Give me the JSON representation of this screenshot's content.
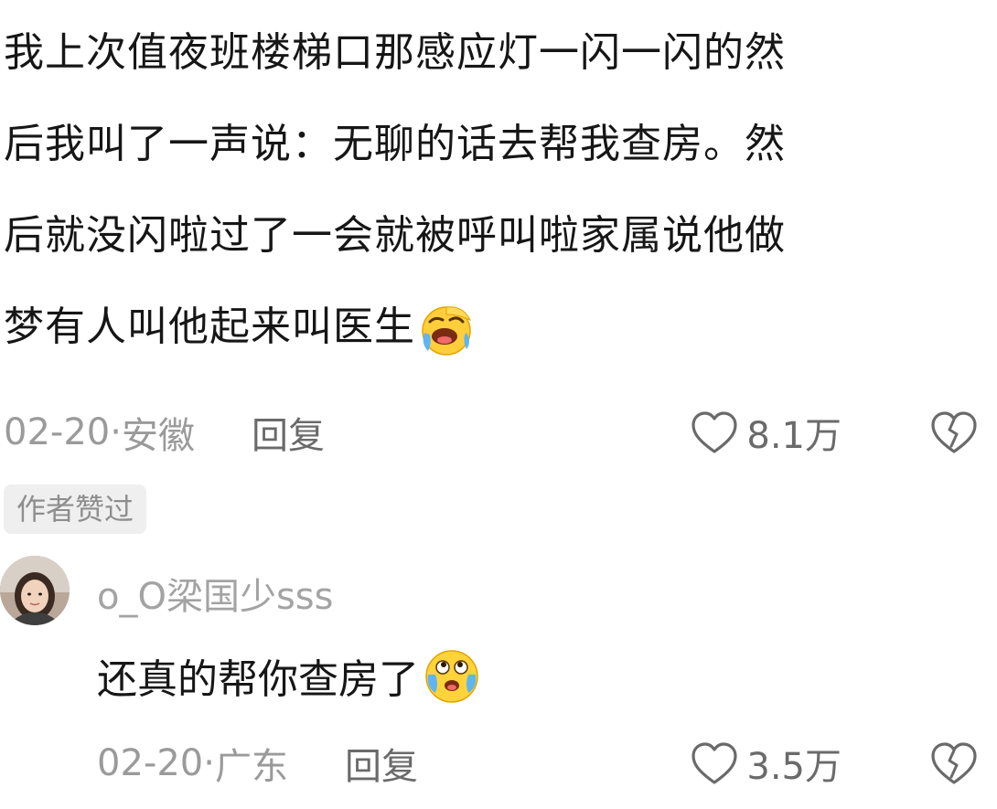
{
  "main_comment": {
    "lines": [
      "我上次值夜班楼梯口那感应灯一闪一闪的然",
      "后我叫了一声说：无聊的话去帮我查房。然",
      "后就没闪啦过了一会就被呼叫啦家属说他做",
      "梦有人叫他起来叫医生"
    ],
    "emoji": "laughing-crying-emoji",
    "date": "02-20",
    "separator": " · ",
    "location": "安徽",
    "reply_label": "回复",
    "like_count": "8.1万"
  },
  "author_liked_badge": "作者赞过",
  "reply_comment": {
    "username": "o_O梁国少sss",
    "text": "还真的帮你查房了",
    "emoji": "crying-laughing-emoji",
    "date": "02-20",
    "separator": " · ",
    "location": "广东",
    "reply_label": "回复",
    "like_count": "3.5万"
  },
  "icons": {
    "like": "heart-outline-icon",
    "dislike": "broken-heart-outline-icon"
  },
  "colors": {
    "text_primary": "#161616",
    "text_muted": "#9a9a9a",
    "badge_bg": "#efefef"
  }
}
